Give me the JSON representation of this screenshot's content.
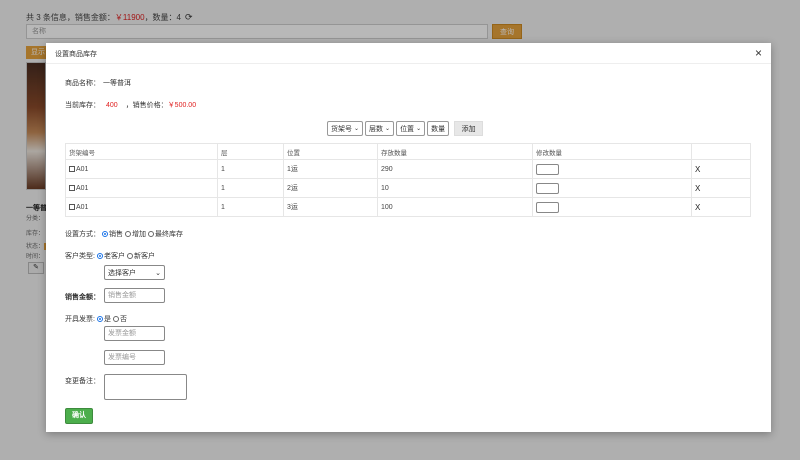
{
  "background": {
    "summary_prefix": "共 3 条信息，销售金额：",
    "summary_amount": "￥11900",
    "summary_sep": "，数量：4",
    "refresh_icon": "⟳",
    "search_placeholder": "名称",
    "query_label": "查询",
    "tag_label": "显示",
    "product_title": "一等普",
    "category_label": "分类：",
    "stock_label": "库存：",
    "status_label": "状态：",
    "time_label": "时间：",
    "edit_icon": "✎"
  },
  "modal": {
    "title": "设置商品库存",
    "close_icon": "×",
    "product_name_label": "商品名称：",
    "product_name": "一等普洱",
    "current_stock_label": "当前库存：",
    "current_stock": "400",
    "price_label": "，销售价格：",
    "price": "￥500.00",
    "toolbar": {
      "shelf_select": "货架号",
      "layer_select": "层数",
      "position_select": "位置",
      "quantity_placeholder": "数量",
      "add_label": "添加"
    },
    "table": {
      "headers": [
        "货架编号",
        "层",
        "位置",
        "存放数量",
        "修改数量",
        ""
      ],
      "rows": [
        {
          "shelf": "A01",
          "layer": "1",
          "position": "1运",
          "qty": "290",
          "delete": "X"
        },
        {
          "shelf": "A01",
          "layer": "1",
          "position": "2运",
          "qty": "10",
          "delete": "X"
        },
        {
          "shelf": "A01",
          "layer": "1",
          "position": "3运",
          "qty": "100",
          "delete": "X"
        }
      ]
    },
    "mode_label": "设置方式：",
    "mode_options": [
      "销售",
      "增加",
      "最终库存"
    ],
    "customer_type_label": "客户类型:",
    "customer_options": [
      "老客户",
      "新客户"
    ],
    "customer_select": "选择客户",
    "sales_amount_label": "销售金额：",
    "sales_amount_placeholder": "销售金额",
    "invoice_label": "开具发票:",
    "invoice_options": [
      "是",
      "否"
    ],
    "invoice_amount_placeholder": "发票金额",
    "invoice_number_placeholder": "发票编号",
    "remark_label": "变更备注：",
    "confirm_label": "确认"
  },
  "colors": {
    "accent_orange": "#e6a23c",
    "confirm_green": "#4cae4c",
    "highlight_red": "#e02020"
  }
}
